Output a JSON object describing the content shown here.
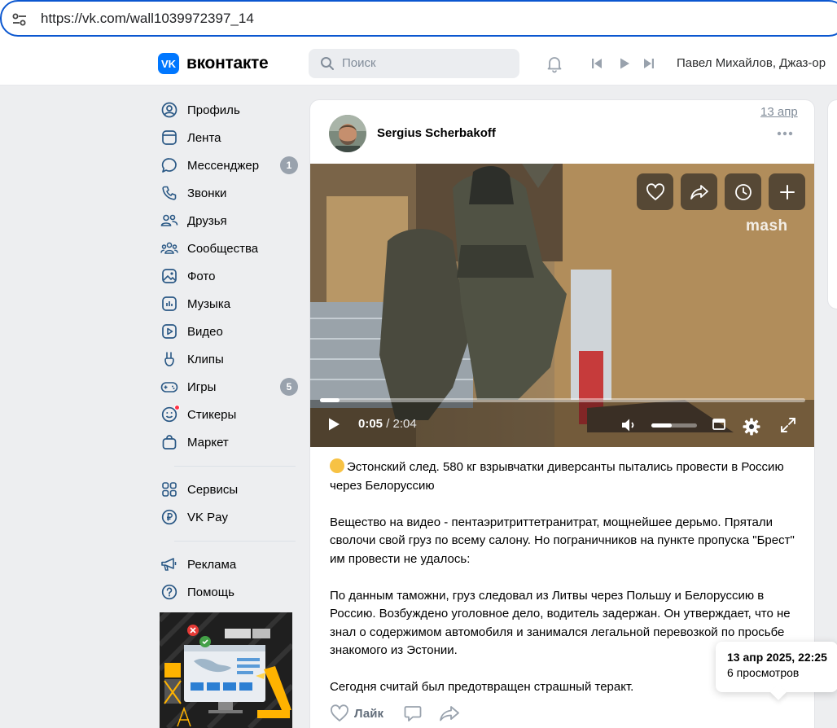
{
  "browser": {
    "url": "https://vk.com/wall1039972397_14"
  },
  "header": {
    "logo_mark": "VK",
    "logo_text": "вконтакте",
    "search_placeholder": "Поиск",
    "now_playing": "Павел Михайлов, Джаз-ор"
  },
  "sidebar": {
    "items": [
      {
        "label": "Профиль",
        "icon": "profile-icon"
      },
      {
        "label": "Лента",
        "icon": "feed-icon"
      },
      {
        "label": "Мессенджер",
        "icon": "messenger-icon",
        "badge": "1"
      },
      {
        "label": "Звонки",
        "icon": "phone-icon"
      },
      {
        "label": "Друзья",
        "icon": "friends-icon"
      },
      {
        "label": "Сообщества",
        "icon": "communities-icon"
      },
      {
        "label": "Фото",
        "icon": "photo-icon"
      },
      {
        "label": "Музыка",
        "icon": "music-icon"
      },
      {
        "label": "Видео",
        "icon": "video-icon"
      },
      {
        "label": "Клипы",
        "icon": "clips-icon"
      },
      {
        "label": "Игры",
        "icon": "games-icon",
        "badge": "5"
      },
      {
        "label": "Стикеры",
        "icon": "stickers-icon"
      },
      {
        "label": "Маркет",
        "icon": "market-icon"
      }
    ],
    "group2": [
      {
        "label": "Сервисы",
        "icon": "services-icon"
      },
      {
        "label": "VK Pay",
        "icon": "vkpay-icon"
      }
    ],
    "group3": [
      {
        "label": "Реклама",
        "icon": "ads-icon"
      },
      {
        "label": "Помощь",
        "icon": "help-icon"
      }
    ]
  },
  "post": {
    "author": "Sergius Scherbakoff",
    "video": {
      "watermark": "mash",
      "current_time": "0:05",
      "duration": "2:04",
      "progress": 0.04,
      "volume": 0.45
    },
    "text": [
      "Эстонский след. 580 кг взрывчатки диверсанты пытались провести в Россию через Белоруссию",
      "Вещество на видео - пентаэритриттетранитрат, мощнейшее дерьмо. Прятали сволочи свой груз по всему салону. Но пограничников на пункте пропуска \"Брест\" им провести не удалось:",
      "По данным таможни, груз следовал из Литвы через Польшу и Белоруссию в Россию. Возбуждено уголовное дело, водитель задержан. Он утверждает, что не знал о содержимом автомобиля и занимался легальной перевозкой по просьбе знакомого из Эстонии.",
      "Сегодня считай был предотвращен страшный теракт."
    ],
    "like_label": "Лайк",
    "date_short": "13 апр",
    "tooltip": {
      "date": "13 апр 2025, 22:25",
      "views": "6 просмотров"
    }
  }
}
